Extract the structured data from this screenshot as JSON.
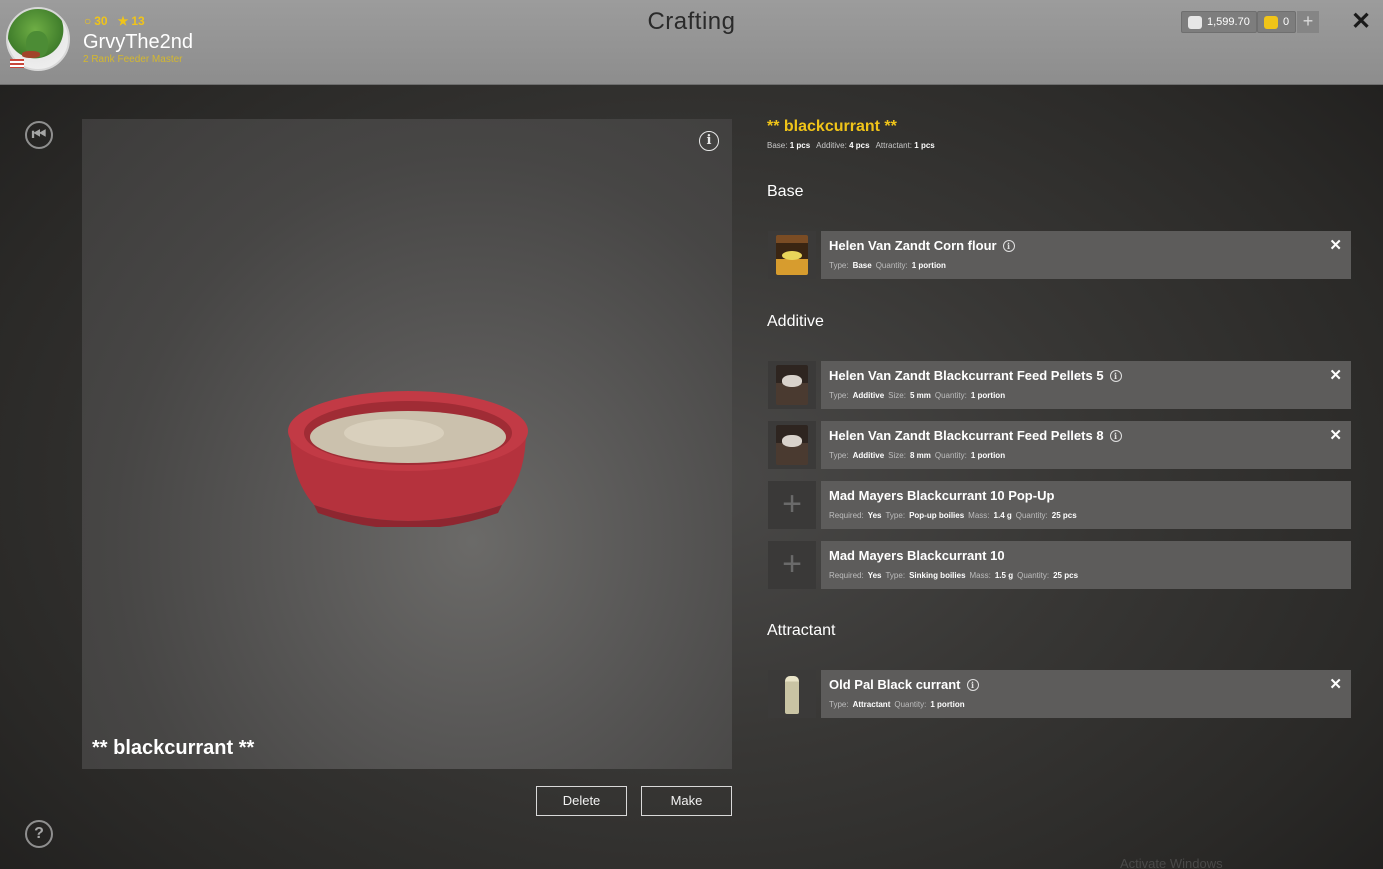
{
  "player": {
    "level": "30",
    "stars": "13",
    "username": "GrvyThe2nd",
    "rank": "2 Rank Feeder Master"
  },
  "header": {
    "title": "Crafting",
    "silver": "1,599.70",
    "gold": "0",
    "plus": "+",
    "close": "✕"
  },
  "sidebar": {
    "back_icon": "⏮",
    "help_icon": "?"
  },
  "preview": {
    "info": "i",
    "name": "** blackcurrant **"
  },
  "actions": {
    "delete": "Delete",
    "make": "Make"
  },
  "recipe": {
    "title": "** blackcurrant **",
    "summary": {
      "base_label": "Base:",
      "base_value": "1 pcs",
      "additive_label": "Additive:",
      "additive_value": "4 pcs",
      "attractant_label": "Attractant:",
      "attractant_value": "1 pcs"
    },
    "sections": {
      "base": "Base",
      "additive": "Additive",
      "attractant": "Attractant"
    },
    "items": [
      {
        "name": "Helen Van Zandt Corn flour",
        "meta": [
          [
            "Type:",
            "Base"
          ],
          [
            "Quantity:",
            "1 portion"
          ]
        ]
      },
      {
        "name": "Helen Van Zandt Blackcurrant Feed Pellets 5",
        "meta": [
          [
            "Type:",
            "Additive"
          ],
          [
            "Size:",
            "5 mm"
          ],
          [
            "Quantity:",
            "1 portion"
          ]
        ]
      },
      {
        "name": "Helen Van Zandt Blackcurrant Feed Pellets 8",
        "meta": [
          [
            "Type:",
            "Additive"
          ],
          [
            "Size:",
            "8 mm"
          ],
          [
            "Quantity:",
            "1 portion"
          ]
        ]
      },
      {
        "name": "Mad Mayers Blackcurrant 10 Pop-Up",
        "meta": [
          [
            "Required:",
            "Yes"
          ],
          [
            "Type:",
            "Pop-up boilies"
          ],
          [
            "Mass:",
            "1.4 g"
          ],
          [
            "Quantity:",
            "25 pcs"
          ]
        ]
      },
      {
        "name": "Mad Mayers Blackcurrant 10",
        "meta": [
          [
            "Required:",
            "Yes"
          ],
          [
            "Type:",
            "Sinking boilies"
          ],
          [
            "Mass:",
            "1.5 g"
          ],
          [
            "Quantity:",
            "25 pcs"
          ]
        ]
      },
      {
        "name": "Old Pal Black currant",
        "meta": [
          [
            "Type:",
            "Attractant"
          ],
          [
            "Quantity:",
            "1 portion"
          ]
        ]
      }
    ],
    "remove": "✕",
    "add": "+",
    "info": "i"
  },
  "watermark": "Activate Windows"
}
